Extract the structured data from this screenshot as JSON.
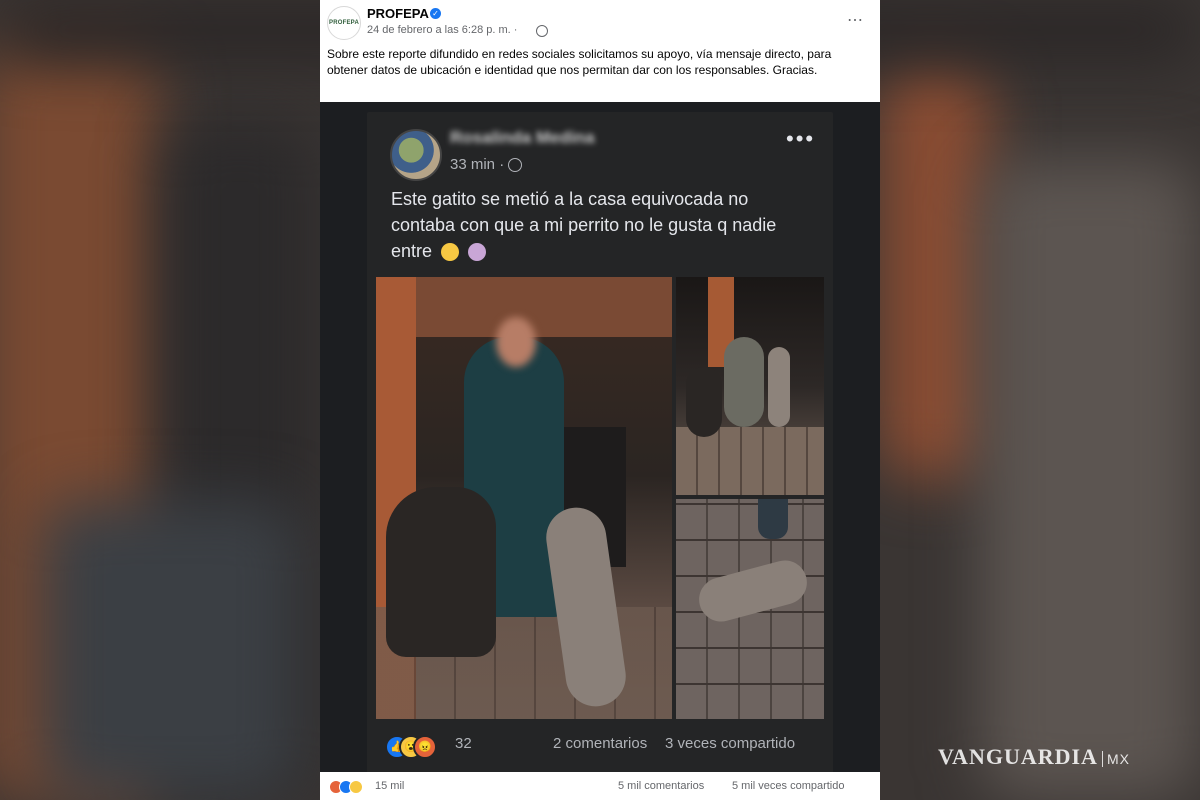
{
  "outer_post": {
    "page_name": "PROFEPA",
    "logo_text": "PROFEPA",
    "date": "24 de febrero a las 6:28 p. m. ·",
    "caption": "Sobre este reporte difundido en redes sociales solicitamos su apoyo, vía mensaje directo, para obtener datos de ubicación e identidad que nos  permitan dar con los responsables. Gracias.",
    "more_icon": "⋯",
    "reactions_count": "15 mil",
    "comments": "5 mil comentarios",
    "shares": "5 mil veces compartido"
  },
  "shared_post": {
    "author": "Rosalinda Medina",
    "time": "33 min ·",
    "text": "Este gatito se metió a la casa equivocada no contaba con que a mi perrito no le gusta q nadie entre",
    "more_icon": "•••",
    "reactions_count": "32",
    "comments": "2 comentarios",
    "shares": "3 veces compartido"
  },
  "watermark": {
    "brand": "VANGUARDIA",
    "region": "MX"
  },
  "colors": {
    "facebook_blue": "#1877f2",
    "dark_card": "#242526"
  }
}
